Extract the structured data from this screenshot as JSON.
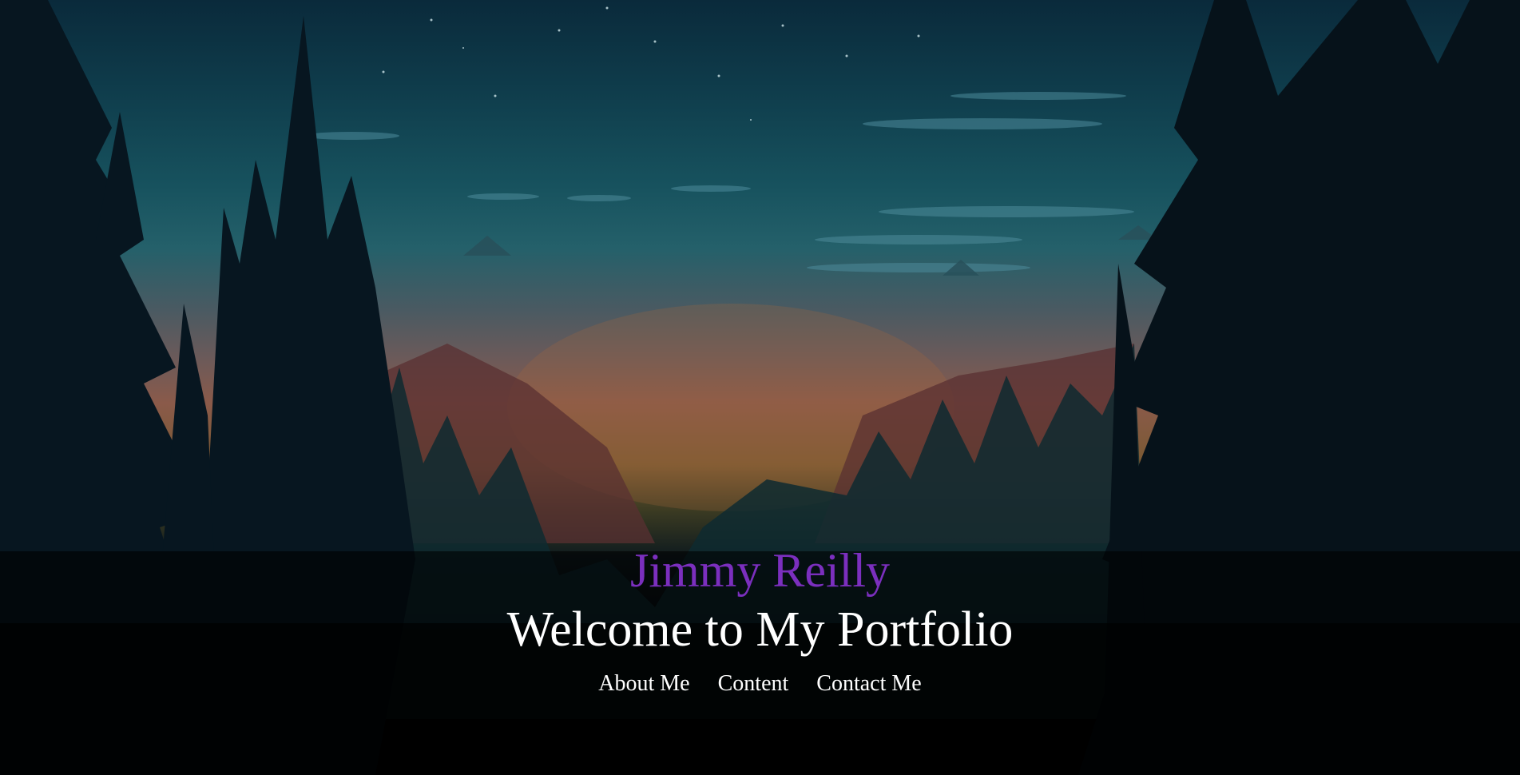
{
  "hero": {
    "name": "Jimmy Reilly",
    "title": "Welcome to My Portfolio"
  },
  "nav": {
    "items": [
      {
        "label": "About Me"
      },
      {
        "label": "Content"
      },
      {
        "label": "Contact Me"
      }
    ]
  },
  "colors": {
    "accent": "#7b2fbe",
    "text": "#ffffff"
  }
}
